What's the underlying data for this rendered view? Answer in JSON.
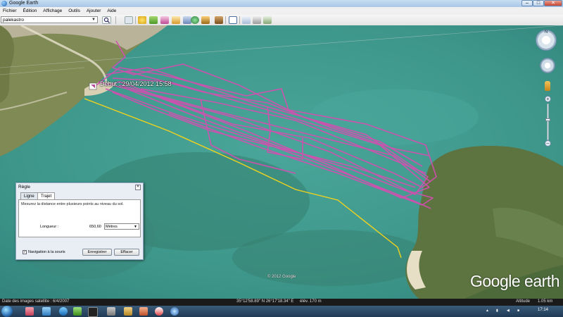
{
  "window": {
    "title": "Google Earth"
  },
  "menu": [
    "Fichier",
    "Édition",
    "Affichage",
    "Outils",
    "Ajouter",
    "Aide"
  ],
  "search": {
    "value": "palekastro"
  },
  "map": {
    "start_label": "Début : 29/04/2012 15:58",
    "copyright": "© 2012 Google",
    "brand": "Google earth",
    "nav": {
      "north": "N"
    }
  },
  "ruler": {
    "title": "Règle",
    "tabs": [
      "Ligne",
      "Trajet"
    ],
    "active_tab": "Trajet",
    "description": "Mesurez la distance entre plusieurs points au niveau du sol.",
    "length_label": "Longueur :",
    "length_value": "650,60",
    "unit": "Mètres",
    "nav_checkbox_label": "Navigation à la souris",
    "save_button": "Enregistrer",
    "clear_button": "Effacer"
  },
  "status": {
    "imagery_date": "Date des images satellite : 6/4/2007",
    "coords": "35°12'58.89\" N   26°17'18.34\" E",
    "elev": "élév.   170 m",
    "altitude_label": "Altitude",
    "altitude": "1.05 km"
  },
  "taskbar": {
    "clock": "17:14"
  },
  "colors": {
    "track": "#d24fb0",
    "path": "#f2d21c"
  }
}
